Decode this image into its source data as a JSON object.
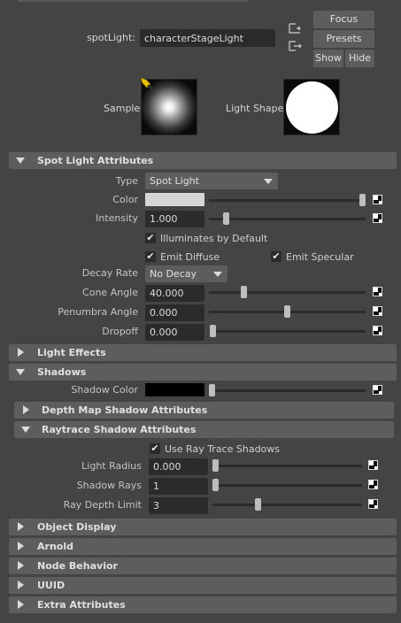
{
  "node": {
    "label": "spotLight:",
    "name": "characterStageLight"
  },
  "buttons": {
    "focus": "Focus",
    "presets": "Presets",
    "show": "Show",
    "hide": "Hide"
  },
  "previews": {
    "sample_label": "Sample",
    "shape_label": "Light Shape"
  },
  "spot": {
    "section": "Spot Light Attributes",
    "type_label": "Type",
    "type_value": "Spot Light",
    "color_label": "Color",
    "color_value": "#d6d6d6",
    "intensity_label": "Intensity",
    "intensity_value": "1.000",
    "illum_label": "Illuminates by Default",
    "diffuse_label": "Emit Diffuse",
    "specular_label": "Emit Specular",
    "decay_label": "Decay Rate",
    "decay_value": "No Decay",
    "cone_label": "Cone Angle",
    "cone_value": "40.000",
    "penumbra_label": "Penumbra Angle",
    "penumbra_value": "0.000",
    "dropoff_label": "Dropoff",
    "dropoff_value": "0.000"
  },
  "light_effects": {
    "section": "Light Effects"
  },
  "shadows": {
    "section": "Shadows",
    "shadow_color_label": "Shadow Color",
    "shadow_color_value": "#000000",
    "depth_map": "Depth Map Shadow Attributes",
    "raytrace": "Raytrace Shadow Attributes",
    "use_rt_label": "Use Ray Trace Shadows",
    "radius_label": "Light Radius",
    "radius_value": "0.000",
    "rays_label": "Shadow Rays",
    "rays_value": "1",
    "depth_label": "Ray Depth Limit",
    "depth_value": "3"
  },
  "collapsed": {
    "object_display": "Object Display",
    "arnold": "Arnold",
    "node_behavior": "Node Behavior",
    "uuid": "UUID",
    "extra": "Extra Attributes"
  }
}
